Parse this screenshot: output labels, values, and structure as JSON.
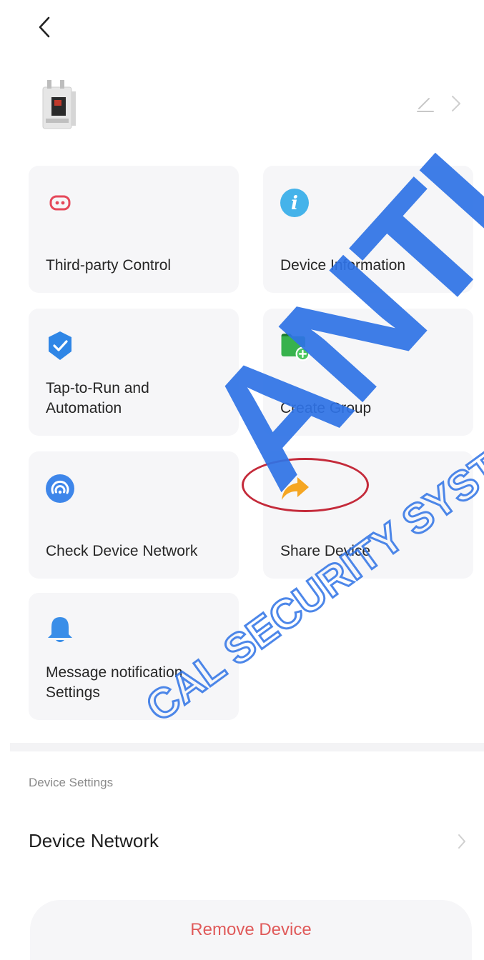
{
  "header": {
    "back_icon": "chevron-left-icon",
    "edit_icon": "pencil-icon",
    "chevron_icon": "chevron-right-icon"
  },
  "cards": [
    {
      "label": "Third-party Control",
      "icon": "link-icon",
      "color": "#e5485a"
    },
    {
      "label": "Device Information",
      "icon": "info-icon",
      "color": "#3fa9e8"
    },
    {
      "label": "Tap-to-Run and Automation",
      "icon": "check-shield-icon",
      "color": "#2f86e6"
    },
    {
      "label": "Create Group",
      "icon": "folder-add-icon",
      "color": "#37b24d"
    },
    {
      "label": "Check Device Network",
      "icon": "network-icon",
      "color": "#3e86ea"
    },
    {
      "label": "Share Device",
      "icon": "share-arrow-icon",
      "color": "#f5a623"
    },
    {
      "label": "Message notification Settings",
      "icon": "bell-icon",
      "color": "#3a8ee8"
    }
  ],
  "settings": {
    "section_title": "Device Settings",
    "device_network_label": "Device Network"
  },
  "remove_button": {
    "label": "Remove Device",
    "color": "#e05a5a"
  },
  "watermark": {
    "text": "ANTI-SB",
    "subtext": "CAL SECURITY SYSTEM",
    "color": "#2f73e6"
  }
}
